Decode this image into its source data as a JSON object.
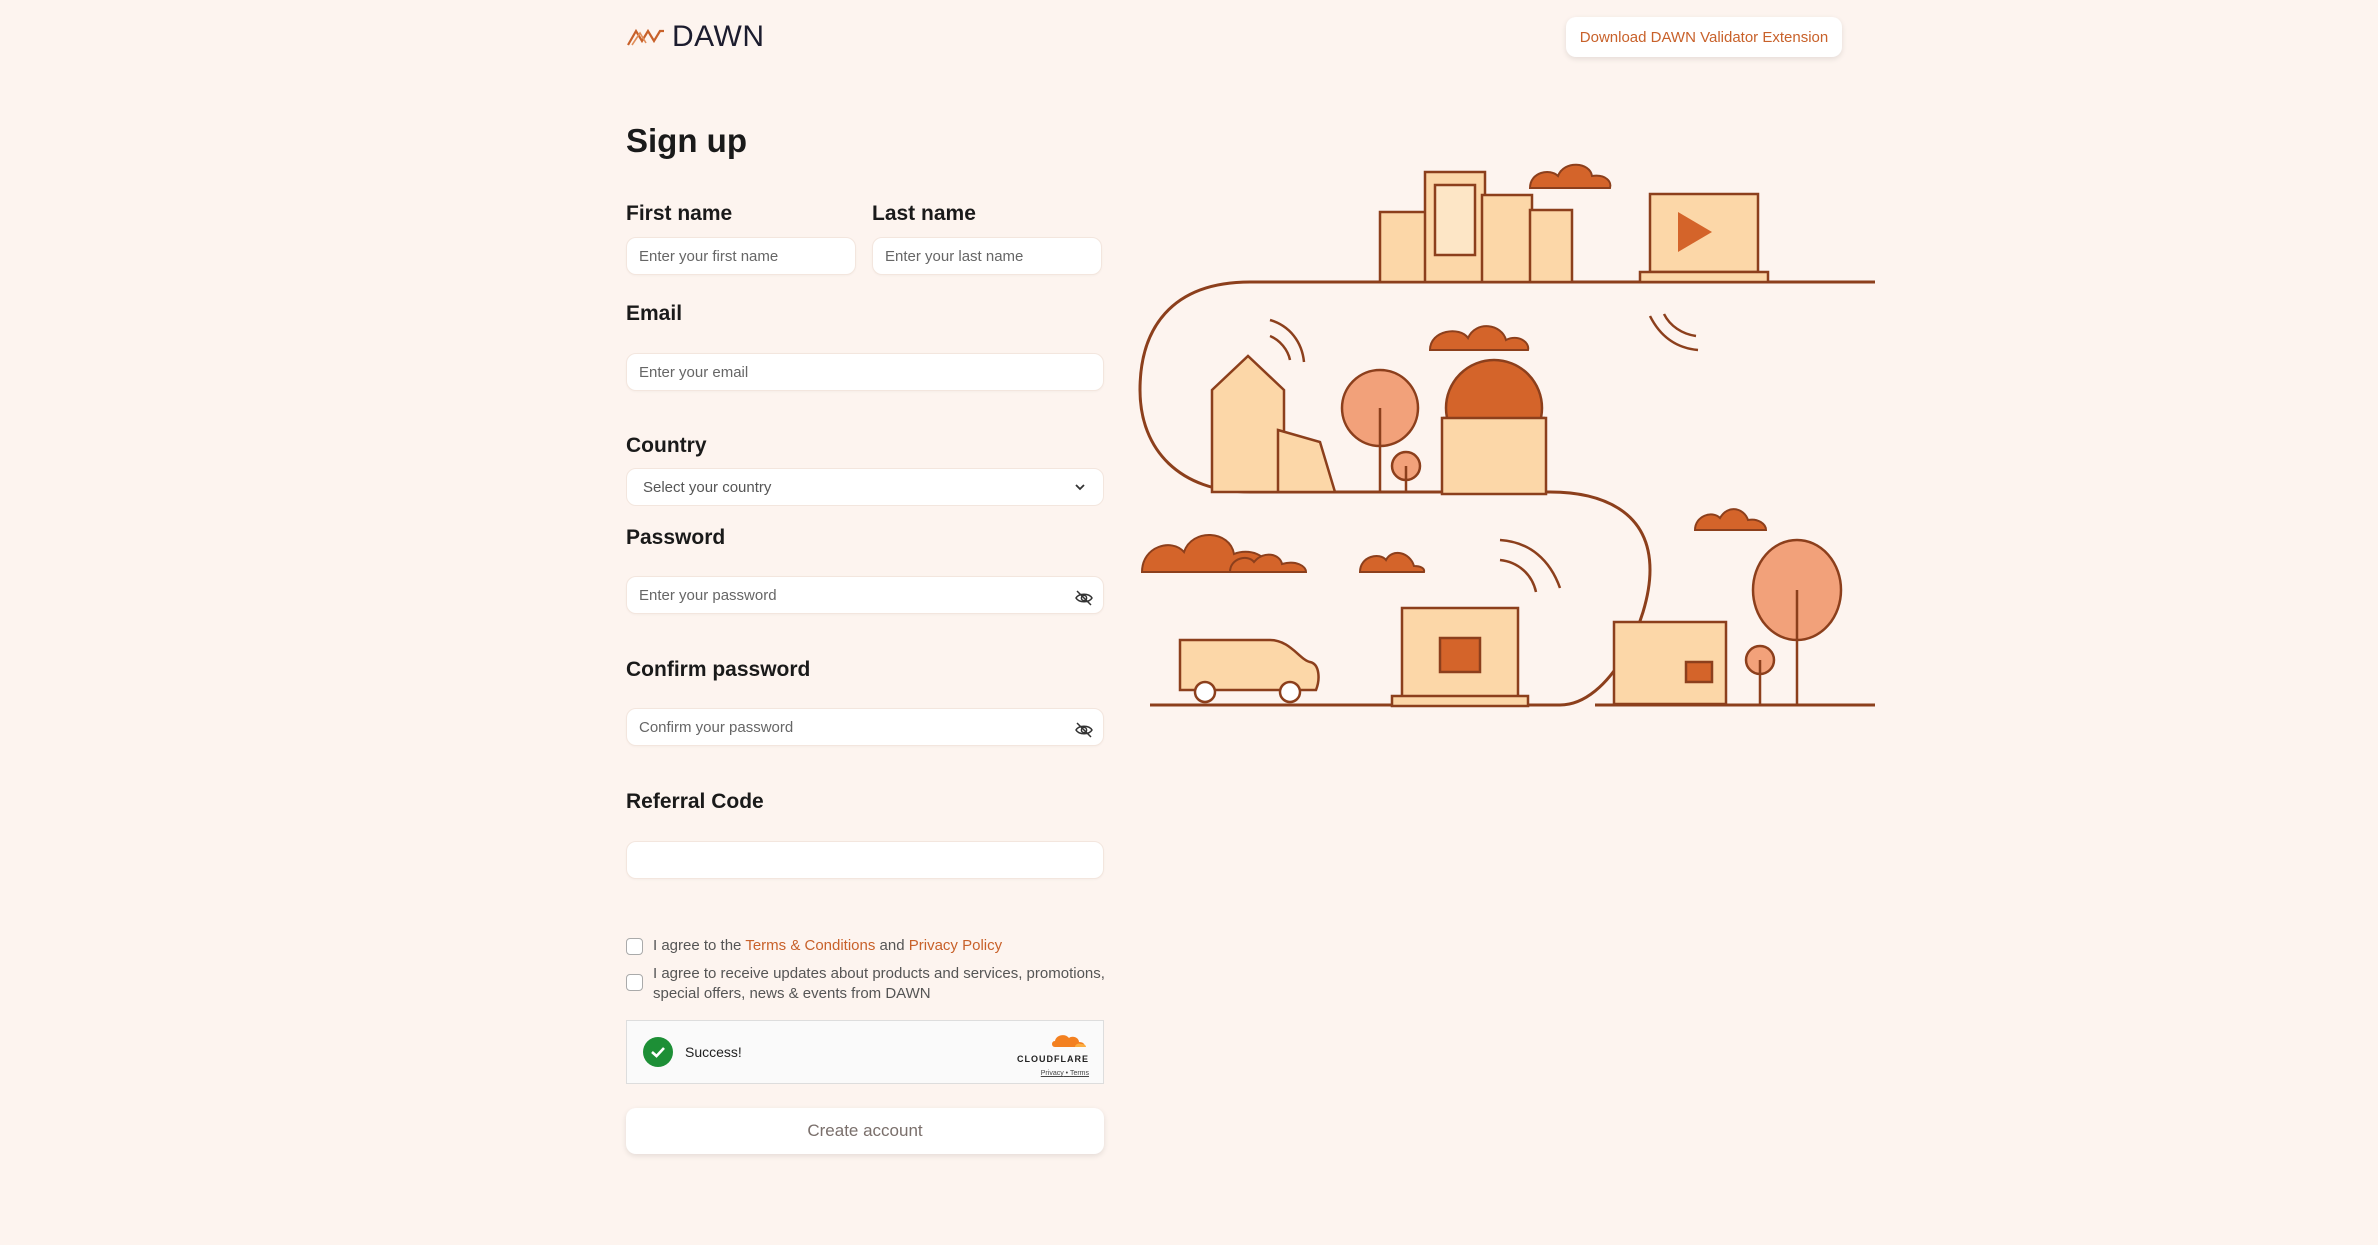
{
  "brand": {
    "name": "DAWN",
    "color": "#c8612a"
  },
  "header": {
    "extension_button": "Download DAWN Validator Extension"
  },
  "form": {
    "title": "Sign up",
    "first_name": {
      "label": "First name",
      "placeholder": "Enter your first name"
    },
    "last_name": {
      "label": "Last name",
      "placeholder": "Enter your last name"
    },
    "email": {
      "label": "Email",
      "placeholder": "Enter your email"
    },
    "country": {
      "label": "Country",
      "value": "Select your country"
    },
    "password": {
      "label": "Password",
      "placeholder": "Enter your password"
    },
    "confirm_password": {
      "label": "Confirm password",
      "placeholder": "Confirm your password"
    },
    "referral": {
      "label": "Referral Code",
      "placeholder": ""
    },
    "terms": {
      "prefix": "I agree to the",
      "terms_link": "Terms & Conditions",
      "and": "and",
      "privacy_link": "Privacy Policy"
    },
    "updates": {
      "text_line1": "I agree to receive updates about products and services, promotions,",
      "text_line2": "special offers, news & events from DAWN"
    },
    "captcha": {
      "status": "Success!",
      "provider": "CLOUDFLARE",
      "privacy": "Privacy",
      "terms": "Terms"
    },
    "submit": "Create account"
  },
  "icons": [
    "eye-off-icon",
    "chevron-down-icon",
    "check-icon",
    "cloudflare-logo"
  ]
}
